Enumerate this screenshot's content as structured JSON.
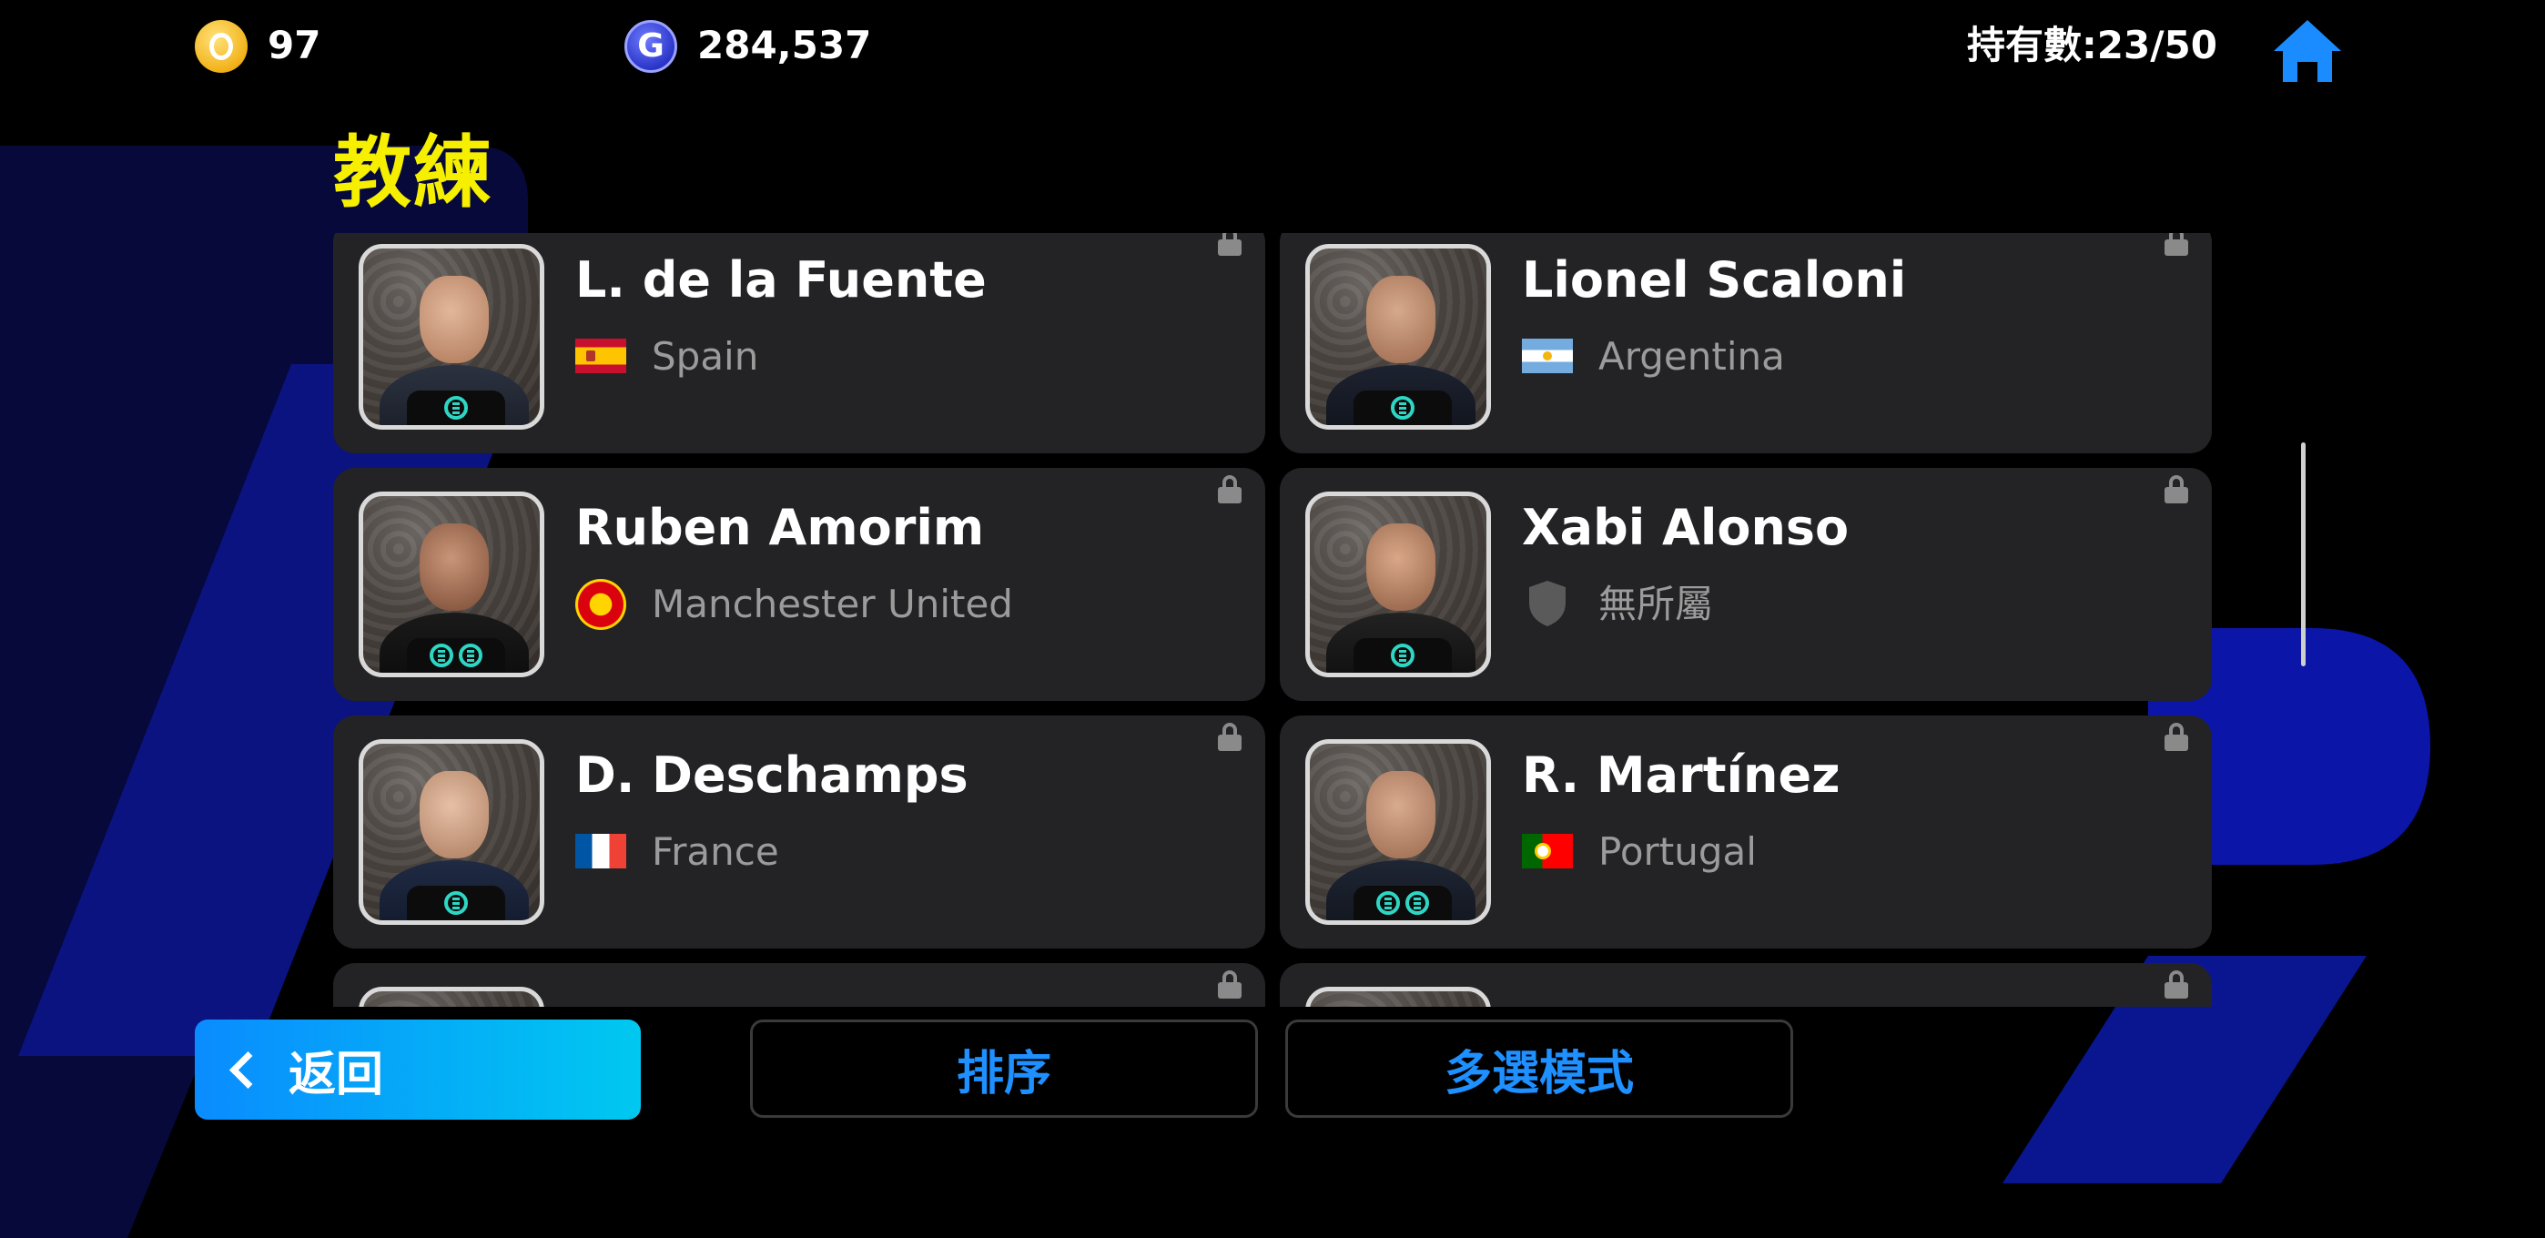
{
  "currency": {
    "ecoins": "97",
    "gp": "284,537",
    "gp_icon_glyph": "G"
  },
  "holding": "持有數:23/50",
  "title": "教練",
  "coaches": [
    {
      "name": "L. de la Fuente",
      "team": "Spain",
      "flag": "spain-flag-icon",
      "badges": 1
    },
    {
      "name": "Lionel Scaloni",
      "team": "Argentina",
      "flag": "argentina-flag-icon",
      "badges": 1
    },
    {
      "name": "Ruben Amorim",
      "team": "Manchester United",
      "flag": "manchester-united-crest-icon",
      "badges": 2
    },
    {
      "name": "Xabi Alonso",
      "team": "無所屬",
      "flag": "shield-icon",
      "badges": 1
    },
    {
      "name": "D. Deschamps",
      "team": "France",
      "flag": "france-flag-icon",
      "badges": 1
    },
    {
      "name": "R. Martínez",
      "team": "Portugal",
      "flag": "portugal-flag-icon",
      "badges": 2
    }
  ],
  "buttons": {
    "back": "返回",
    "sort": "排序",
    "multi_select": "多選模式"
  },
  "colors": {
    "title": "#f6f000",
    "accent": "#1e90ff",
    "card": "#232325",
    "badge": "#2ed6c4"
  }
}
